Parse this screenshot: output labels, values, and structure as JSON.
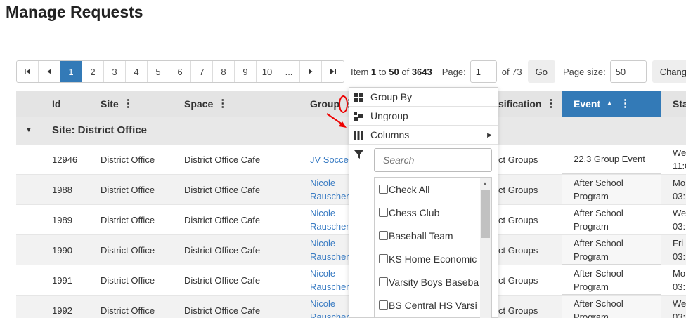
{
  "page": {
    "title": "Manage Requests"
  },
  "pager": {
    "first_icon": "first-page-icon",
    "prev_icon": "prev-page-icon",
    "pages": [
      "1",
      "2",
      "3",
      "4",
      "5",
      "6",
      "7",
      "8",
      "9",
      "10",
      "..."
    ],
    "active_page": "1",
    "next_icon": "next-page-icon",
    "last_icon": "last-page-icon",
    "item_prefix": "Item",
    "item_from": "1",
    "item_to_word": "to",
    "item_to": "50",
    "item_of_word": "of",
    "item_total": "3643",
    "page_label": "Page:",
    "page_value": "1",
    "of_pages": "of 73",
    "go_label": "Go",
    "size_label": "Page size:",
    "size_value": "50",
    "change_label": "Change"
  },
  "columns": {
    "id": "Id",
    "site": "Site",
    "space": "Space",
    "group": "Group",
    "classification": "sification",
    "event": "Event",
    "start": "Sta",
    "kebab": "⋮",
    "sort_icon": "▲"
  },
  "group_row": {
    "label": "Site: District Office"
  },
  "rows": [
    {
      "id": "12946",
      "site": "District Office",
      "space": "District Office Cafe",
      "group1": "JV Socce",
      "group2": "",
      "cls": "ct Groups",
      "event1": "22.3 Group Event",
      "event2": "",
      "start1": "We",
      "start2": "11:0"
    },
    {
      "id": "1988",
      "site": "District Office",
      "space": "District Office Cafe",
      "group1": "Nicole",
      "group2": "Rauscher",
      "cls": "ct Groups",
      "event1": "After School",
      "event2": "Program",
      "start1": "Mo",
      "start2": "03:"
    },
    {
      "id": "1989",
      "site": "District Office",
      "space": "District Office Cafe",
      "group1": "Nicole",
      "group2": "Rauscher",
      "cls": "ct Groups",
      "event1": "After School",
      "event2": "Program",
      "start1": "We",
      "start2": "03:"
    },
    {
      "id": "1990",
      "site": "District Office",
      "space": "District Office Cafe",
      "group1": "Nicole",
      "group2": "Rauscher",
      "cls": "ct Groups",
      "event1": "After School",
      "event2": "Program",
      "start1": "Fri",
      "start2": "03:"
    },
    {
      "id": "1991",
      "site": "District Office",
      "space": "District Office Cafe",
      "group1": "Nicole",
      "group2": "Rauscher",
      "cls": "ct Groups",
      "event1": "After School",
      "event2": "Program",
      "start1": "Mo",
      "start2": "03:"
    },
    {
      "id": "1992",
      "site": "District Office",
      "space": "District Office Cafe",
      "group1": "Nicole",
      "group2": "Rauscher",
      "cls": "ct Groups",
      "event1": "After School",
      "event2": "Program",
      "start1": "We",
      "start2": "03:"
    }
  ],
  "menu": {
    "group_by": "Group By",
    "ungroup": "Ungroup",
    "columns": "Columns",
    "search_placeholder": "Search",
    "filter_items": [
      "Check All",
      "Chess Club",
      "Baseball Team",
      "KS Home Economic",
      "Varsity Boys Baseba",
      "BS Central HS Varsi"
    ]
  },
  "colors": {
    "accent": "#337ab7",
    "link": "#3a7cc3",
    "annotation": "#e00000"
  }
}
